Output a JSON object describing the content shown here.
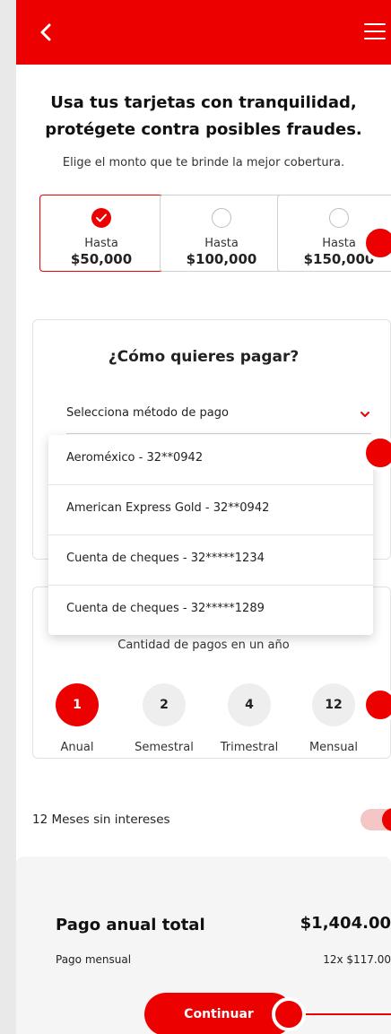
{
  "header": {
    "back_icon": "chevron-left-icon",
    "menu_icon": "hamburger-menu-icon",
    "color": "#ec0000"
  },
  "intro": {
    "headline_line1": "Usa tus tarjetas con tranquilidad,",
    "headline_line2": "protégete contra posibles fraudes.",
    "subhead": "Elige el monto que te brinde la mejor cobertura."
  },
  "coverage": {
    "options": [
      {
        "line1": "Hasta",
        "line2": "$50,000",
        "selected": true
      },
      {
        "line1": "Hasta",
        "line2": "$100,000",
        "selected": false
      },
      {
        "line1": "Hasta",
        "line2": "$150,000",
        "selected": false
      }
    ]
  },
  "payment": {
    "title": "¿Cómo quieres pagar?",
    "select_value": "Selecciona método de pago",
    "methods": [
      "Aeroméxico - 32**0942",
      "American Express Gold - 32**0942",
      "Cuenta de cheques - 32*****1234",
      "Cuenta de cheques - 32*****1289"
    ]
  },
  "frequency": {
    "label": "Cantidad de pagos en un año",
    "options": [
      {
        "value": "1",
        "label": "Anual",
        "active": true
      },
      {
        "value": "2",
        "label": "Semestral",
        "active": false
      },
      {
        "value": "4",
        "label": "Trimestral",
        "active": false
      },
      {
        "value": "12",
        "label": "Mensual",
        "active": false
      }
    ]
  },
  "msi": {
    "label": "12 Meses sin intereses",
    "enabled": true
  },
  "summary": {
    "total_label": "Pago anual total",
    "total_value": "$1,404.00",
    "monthly_label": "Pago mensual",
    "monthly_value": "12x $117.00"
  },
  "cta": {
    "label": "Continuar"
  }
}
